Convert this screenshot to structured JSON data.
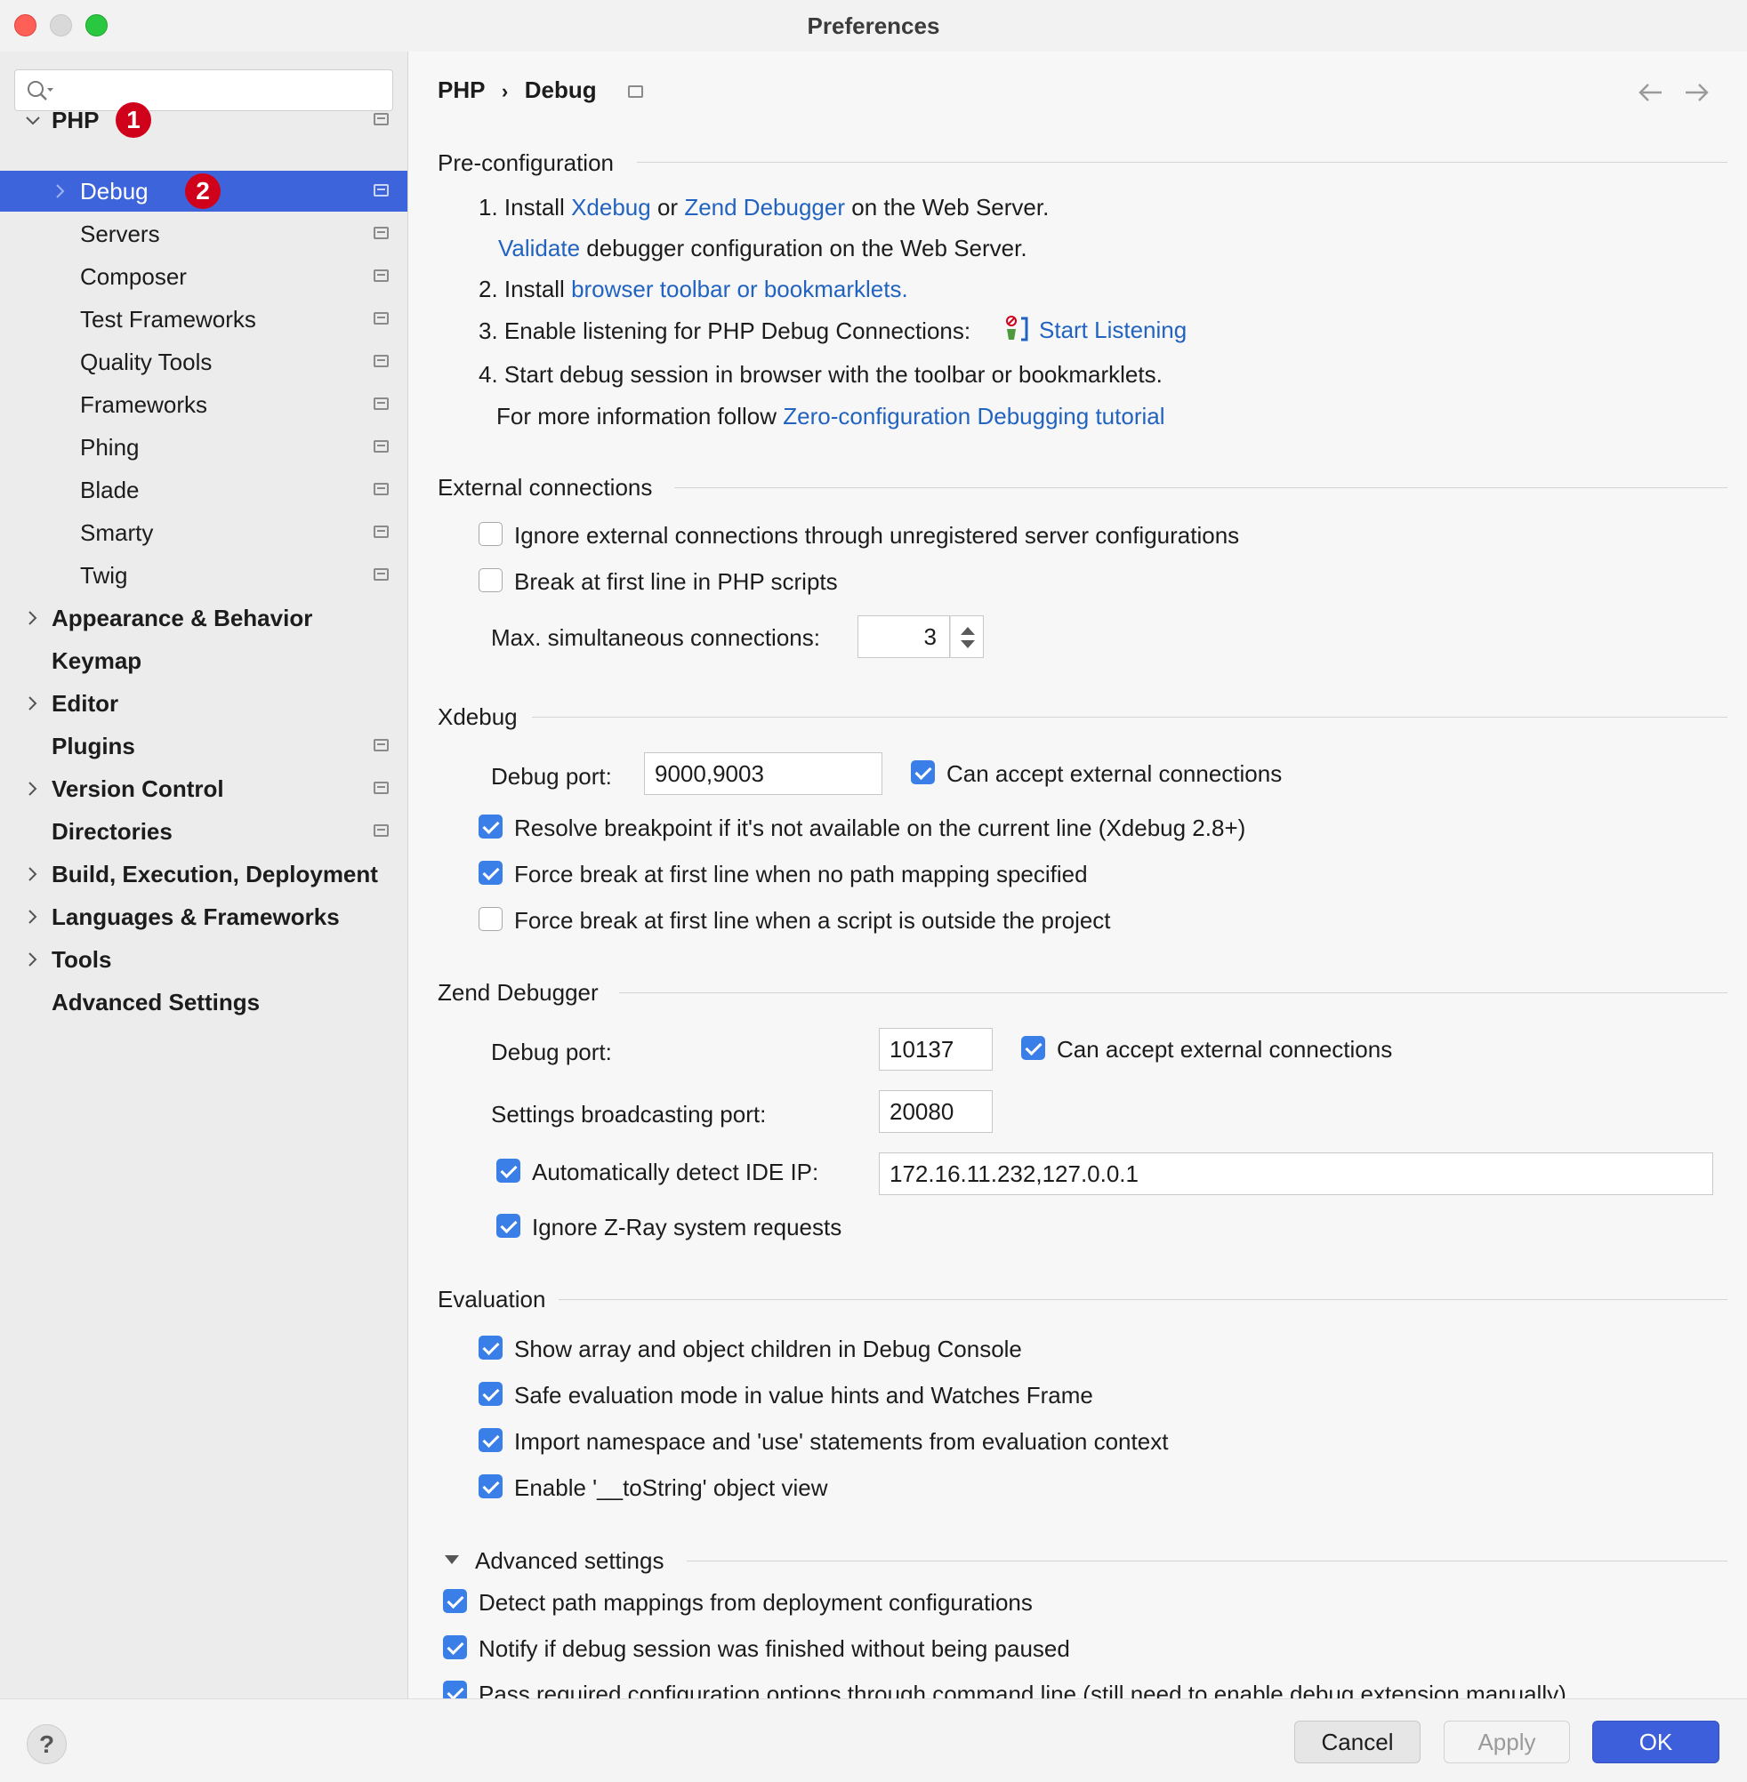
{
  "window": {
    "title": "Preferences"
  },
  "search": {
    "placeholder": ""
  },
  "sidebar": {
    "items": [
      {
        "label": "PHP",
        "badge": "1"
      },
      {
        "label": "Debug",
        "badge": "2"
      },
      {
        "label": "Servers"
      },
      {
        "label": "Composer"
      },
      {
        "label": "Test Frameworks"
      },
      {
        "label": "Quality Tools"
      },
      {
        "label": "Frameworks"
      },
      {
        "label": "Phing"
      },
      {
        "label": "Blade"
      },
      {
        "label": "Smarty"
      },
      {
        "label": "Twig"
      },
      {
        "label": "Appearance & Behavior"
      },
      {
        "label": "Keymap"
      },
      {
        "label": "Editor"
      },
      {
        "label": "Plugins"
      },
      {
        "label": "Version Control"
      },
      {
        "label": "Directories"
      },
      {
        "label": "Build, Execution, Deployment"
      },
      {
        "label": "Languages & Frameworks"
      },
      {
        "label": "Tools"
      },
      {
        "label": "Advanced Settings"
      }
    ]
  },
  "breadcrumb": {
    "parent": "PHP",
    "separator": "›",
    "current": "Debug"
  },
  "preconfig": {
    "title": "Pre-configuration",
    "step1_prefix": "1. Install",
    "step1_link1": "Xdebug",
    "step1_or": "or",
    "step1_link2": "Zend Debugger",
    "step1_suffix": "on the Web Server.",
    "validate_link": "Validate",
    "validate_suffix": "debugger configuration on the Web Server.",
    "step2_prefix": "2. Install",
    "step2_link": "browser toolbar or bookmarklets.",
    "step3_text": "3. Enable listening for PHP Debug Connections:",
    "step3_link": "Start Listening",
    "step4_text": "4. Start debug session in browser with the toolbar or bookmarklets.",
    "more_prefix": "For more information follow",
    "more_link": "Zero-configuration Debugging tutorial"
  },
  "external": {
    "title": "External connections",
    "ignore_label": "Ignore external connections through unregistered server configurations",
    "ignore_checked": false,
    "break_label": "Break at first line in PHP scripts",
    "break_checked": false,
    "max_label": "Max. simultaneous connections:",
    "max_value": "3"
  },
  "xdebug": {
    "title": "Xdebug",
    "port_label": "Debug port:",
    "port_value": "9000,9003",
    "accept_label": "Can accept external connections",
    "accept_checked": true,
    "resolve_label": "Resolve breakpoint if it's not available on the current line (Xdebug 2.8+)",
    "resolve_checked": true,
    "force_nomap_label": "Force break at first line when no path mapping specified",
    "force_nomap_checked": true,
    "force_outside_label": "Force break at first line when a script is outside the project",
    "force_outside_checked": false
  },
  "zend": {
    "title": "Zend Debugger",
    "port_label": "Debug port:",
    "port_value": "10137",
    "accept_label": "Can accept external connections",
    "accept_checked": true,
    "broadcast_label": "Settings broadcasting port:",
    "broadcast_value": "20080",
    "autodetect_label": "Automatically detect IDE IP:",
    "autodetect_checked": true,
    "ip_value": "172.16.11.232,127.0.0.1",
    "zray_label": "Ignore Z-Ray system requests",
    "zray_checked": true
  },
  "evaluation": {
    "title": "Evaluation",
    "show_array_label": "Show array and object children in Debug Console",
    "safe_eval_label": "Safe evaluation mode in value hints and Watches Frame",
    "import_ns_label": "Import namespace and 'use' statements from evaluation context",
    "tostring_label": "Enable '__toString' object view"
  },
  "advanced": {
    "title": "Advanced settings",
    "detect_label": "Detect path mappings from deployment configurations",
    "notify_label": "Notify if debug session was finished without being paused",
    "pass_label": "Pass required configuration options through command line (still need to enable debug extension manually)"
  },
  "footer": {
    "help": "?",
    "cancel": "Cancel",
    "apply": "Apply",
    "ok": "OK"
  }
}
